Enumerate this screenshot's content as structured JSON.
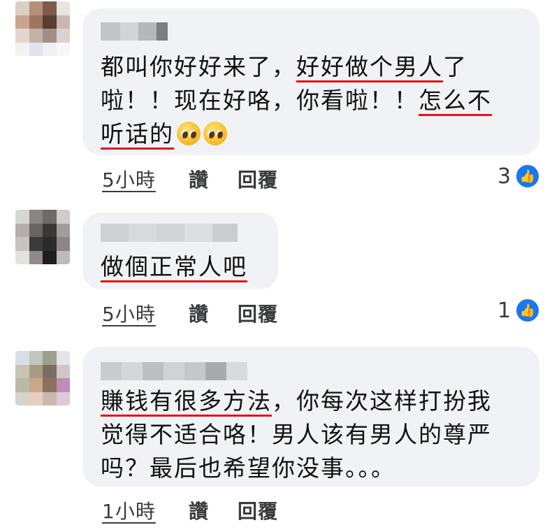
{
  "comments": [
    {
      "text_line1_a": "都叫你好好来了，",
      "text_line1_b": "好好做个男人",
      "text_line1_c": "了",
      "text_line2_a": "啦！！现在好咯，你看啦！！",
      "text_line2_b": "怎么不",
      "text_line3": "听话的",
      "emojis": [
        "pleading-face-emoji",
        "pleading-face-emoji"
      ],
      "time": "5小時",
      "like_label": "讚",
      "reply_label": "回覆",
      "like_count": "3"
    },
    {
      "text_line1": "做個正常人吧",
      "time": "5小時",
      "like_label": "讚",
      "reply_label": "回覆",
      "like_count": "1"
    },
    {
      "text_line1_a": "賺钱有很多方法",
      "text_line1_b": "，你每次这样打扮我",
      "text_line2": "觉得不适合咯！男人该有男人的尊严",
      "text_line3": "吗？最后也希望你没事。。。",
      "time": "1小時",
      "like_label": "讚",
      "reply_label": "回覆"
    }
  ],
  "colors": {
    "bubble": "#f0f2f5",
    "underline": "#e01818",
    "like_badge": "#1877f2"
  },
  "icons": {
    "like": "thumbs-up-icon"
  }
}
